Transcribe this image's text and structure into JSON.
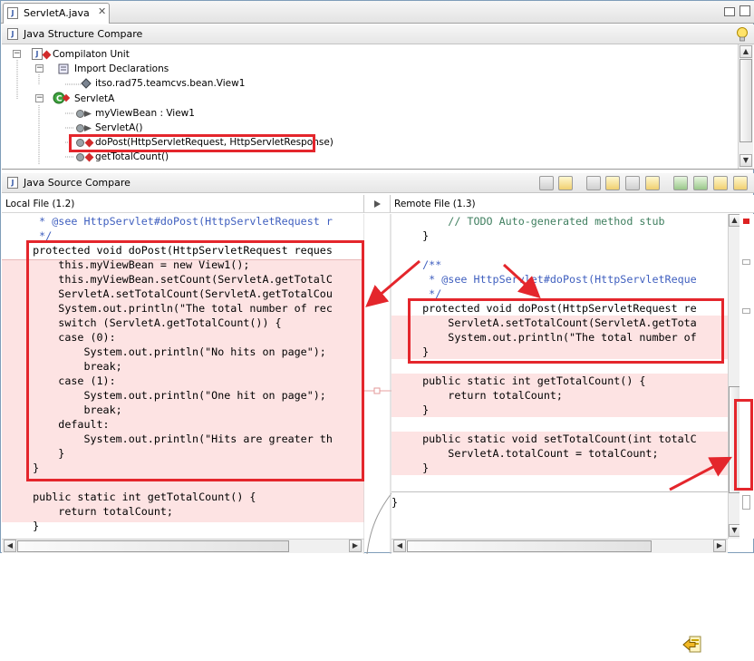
{
  "editor": {
    "tab_label": "ServletA.java",
    "tab_icon": "java-file-icon",
    "close_glyph": "✕"
  },
  "structure": {
    "title": "Java Structure Compare",
    "nodes": [
      {
        "label": "Compilaton Unit",
        "icon": "compilation-unit-icon"
      },
      {
        "label": "Import Declarations",
        "icon": "import-icon"
      },
      {
        "label": "itso.rad75.teamcvs.bean.View1",
        "icon": "import-item-icon"
      },
      {
        "label": "ServletA",
        "icon": "class-icon"
      },
      {
        "label": "myViewBean : View1",
        "icon": "field-icon"
      },
      {
        "label": "ServletA()",
        "icon": "method-icon"
      },
      {
        "label": "doPost(HttpServletRequest, HttpServletResponse)",
        "icon": "method-icon"
      },
      {
        "label": "getTotalCount()",
        "icon": "method-icon"
      }
    ]
  },
  "source": {
    "title": "Java Source Compare",
    "local_label": "Local File (1.2)",
    "remote_label": "Remote File (1.3)"
  },
  "local_code": [
    "     * @see HttpServlet#doPost(HttpServletRequest r",
    "     */",
    "    protected void doPost(HttpServletRequest reques",
    "        this.myViewBean = new View1();",
    "        this.myViewBean.setCount(ServletA.getTotalC",
    "        ServletA.setTotalCount(ServletA.getTotalCou",
    "        System.out.println(\"The total number of rec",
    "        switch (ServletA.getTotalCount()) {",
    "        case (0):",
    "            System.out.println(\"No hits on page\");",
    "            break;",
    "        case (1):",
    "            System.out.println(\"One hit on page\");",
    "            break;",
    "        default:",
    "            System.out.println(\"Hits are greater th",
    "        }",
    "    }",
    "",
    "    public static int getTotalCount() {",
    "        return totalCount;",
    "    }"
  ],
  "remote_code": [
    "        // TODO Auto-generated method stub",
    "    }",
    "",
    "    /**",
    "     * @see HttpServlet#doPost(HttpServletReque",
    "     */",
    "    protected void doPost(HttpServletRequest re",
    "        ServletA.setTotalCount(ServletA.getTota",
    "        System.out.println(\"The total number of",
    "    }",
    "",
    "    public static int getTotalCount() {",
    "        return totalCount;",
    "    }",
    "",
    "    public static void setTotalCount(int totalC",
    "        ServletA.totalCount = totalCount;",
    "    }",
    "",
    "",
    "}"
  ],
  "colors": {
    "highlight_box": "#e4262c",
    "change_bg": "#fde3e3",
    "keyword": "#7f0055",
    "string": "#2a00ff",
    "comment": "#3f7f5f",
    "javadoc": "#3f5fbf"
  },
  "bottom_icon": "copy-current-change-icon"
}
